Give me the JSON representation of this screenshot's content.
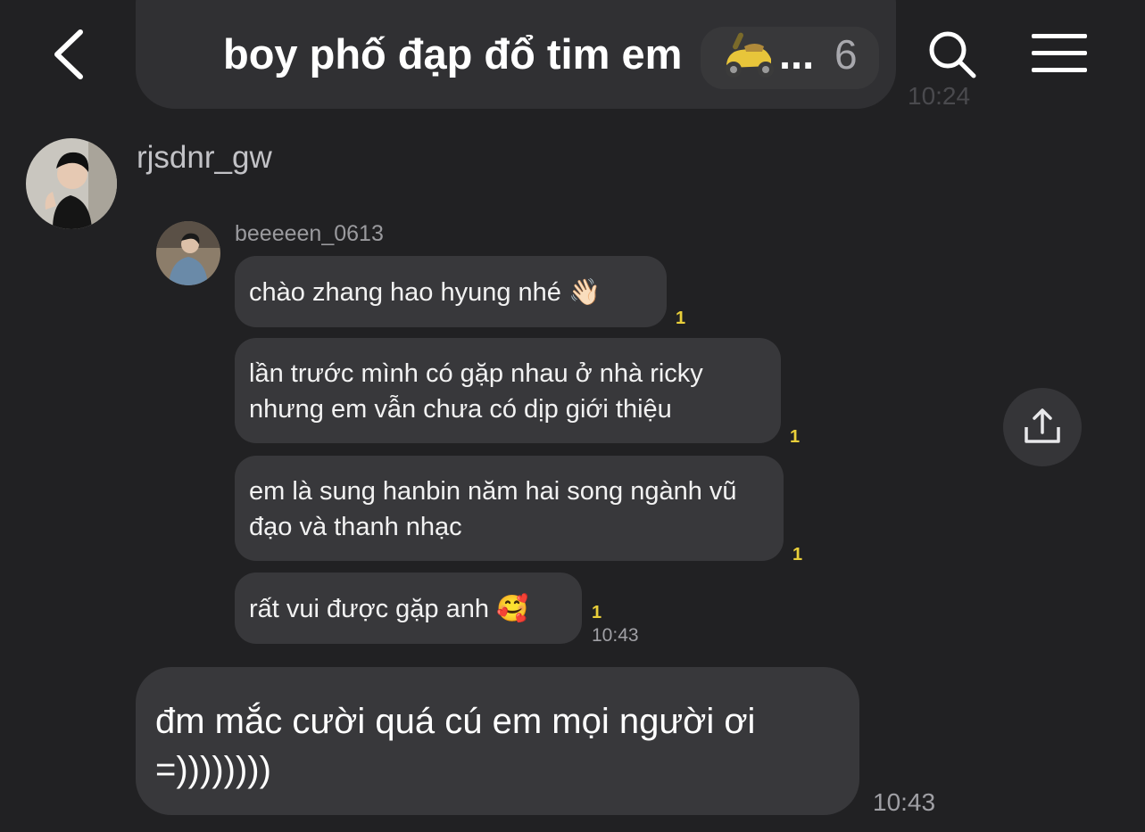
{
  "header": {
    "title": "boy phố đạp đổ tim em",
    "title_suffix": "...",
    "member_count": "6",
    "scooter_icon": "scooter-emoji-icon",
    "back_icon": "back-chevron-icon",
    "search_icon": "search-icon",
    "menu_icon": "menu-icon"
  },
  "previous_message": {
    "time": "10:24"
  },
  "sender": {
    "name": "rjsdnr_gw"
  },
  "quoted": {
    "author": "beeeeen_0613",
    "messages": [
      {
        "text": "chào zhang hao hyung nhé",
        "emoji": "👋🏻",
        "read": "1"
      },
      {
        "text": "lần trước mình có gặp nhau ở nhà ricky nhưng em vẫn chưa có dịp giới thiệu",
        "read": "1"
      },
      {
        "text": "em là sung hanbin năm hai song ngành vũ đạo và thanh nhạc",
        "read": "1"
      },
      {
        "text": "rất vui được gặp anh",
        "emoji": "🥰",
        "read": "1"
      }
    ],
    "time": "10:43"
  },
  "share_icon": "share-icon",
  "main_message": {
    "text": "đm mắc cười quá cú em mọi người ơi =))))))))",
    "time": "10:43"
  },
  "colors": {
    "background": "#212123",
    "bubble": "#38383b",
    "read_count": "#e9cf3a"
  }
}
